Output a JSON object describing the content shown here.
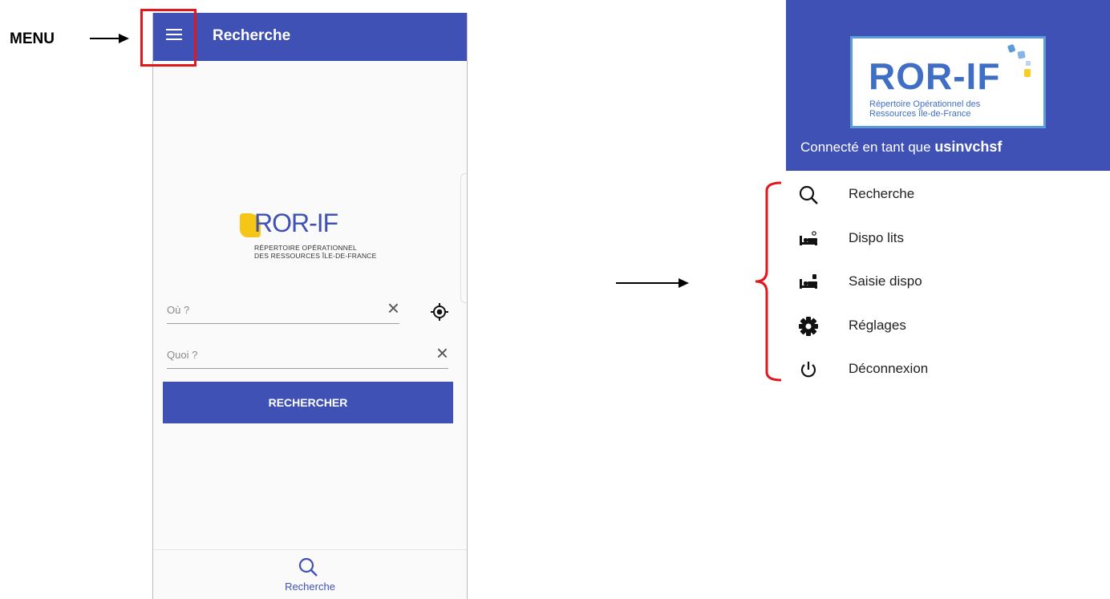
{
  "annotation": {
    "menu_label": "MENU"
  },
  "app": {
    "title": "Recherche",
    "logo": {
      "word": "ROR-IF",
      "line1": "RÉPERTOIRE OPÉRATIONNEL",
      "line2": "DES RESSOURCES ÎLE-DE-FRANCE"
    },
    "fields": [
      {
        "placeholder": "Où ?"
      },
      {
        "placeholder": "Quoi ?"
      }
    ],
    "search_button": "RECHERCHER",
    "bottom_nav": {
      "label": "Recherche"
    }
  },
  "drawer": {
    "logo": {
      "word": "ROR-IF",
      "line1": "Répertoire Opérationnel des",
      "line2": "Ressources Île-de-France"
    },
    "connected_prefix": "Connecté en tant que",
    "username": "usinvchsf",
    "items": [
      {
        "label": "Recherche",
        "icon": "search-icon"
      },
      {
        "label": "Dispo lits",
        "icon": "bed-search-icon"
      },
      {
        "label": "Saisie dispo",
        "icon": "bed-edit-icon"
      },
      {
        "label": "Réglages",
        "icon": "gear-icon"
      },
      {
        "label": "Déconnexion",
        "icon": "power-icon"
      }
    ]
  },
  "colors": {
    "primary": "#3f51b5",
    "annotation_red": "#e3161b",
    "logo_yellow": "#f5c518"
  }
}
